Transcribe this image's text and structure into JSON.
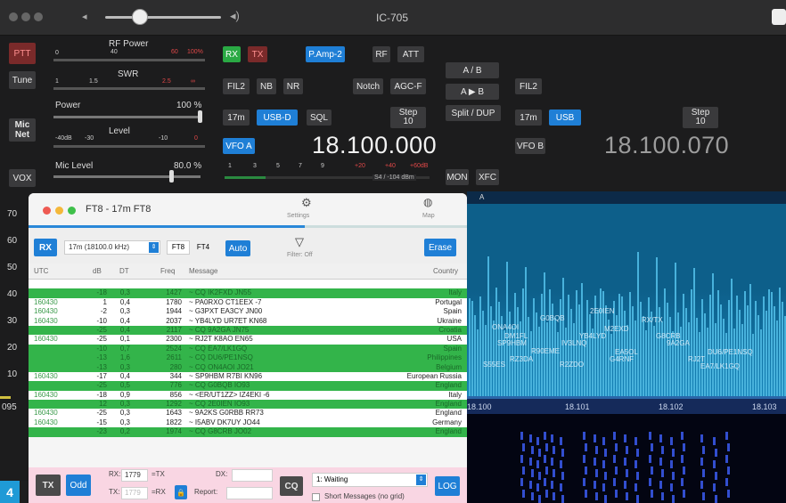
{
  "window": {
    "title": "IC-705"
  },
  "radio": {
    "ptt": "PTT",
    "tune": "Tune",
    "mic_net": "Mic\nNet",
    "vox": "VOX",
    "rf_power_label": "RF Power",
    "swr_label": "SWR",
    "power_label": "Power",
    "power_value": "100 %",
    "level_label": "Level",
    "mic_level_label": "Mic Level",
    "mic_level_value": "80.0 %",
    "rx": "RX",
    "tx": "TX",
    "pamp": "P.Amp-2",
    "rf": "RF",
    "att": "ATT",
    "fil2": "FIL2",
    "nb": "NB",
    "nr": "NR",
    "notch": "Notch",
    "agcf": "AGC-F",
    "band_a": "17m",
    "mode_a": "USB-D",
    "sql": "SQL",
    "step_label": "Step",
    "step_value": "10",
    "vfo_a": "VFO A",
    "freq_a": "18.100.000",
    "ab": "A / B",
    "a_to_b": "A ▶ B",
    "split": "Split / DUP",
    "fil2_b": "FIL2",
    "band_b": "17m",
    "mode_b": "USB",
    "step_b_label": "Step",
    "step_b_value": "10",
    "vfo_b": "VFO B",
    "freq_b": "18.100.070",
    "mon": "MON",
    "xfc": "XFC",
    "smeter_readout": "S4 / -104 dBm",
    "rf_ticks": [
      "0",
      "40",
      "60",
      "100%"
    ],
    "swr_ticks": [
      "1",
      "1.5",
      "2.5",
      "∞"
    ],
    "level_ticks": [
      "-40dB",
      "-30",
      "-10",
      "0"
    ],
    "s_ticks": [
      "1",
      "3",
      "5",
      "7",
      "9",
      "+20",
      "+40",
      "+60dB"
    ]
  },
  "axis_db": [
    "70",
    "60",
    "50",
    "40",
    "30",
    "20",
    "10"
  ],
  "axis_left_bottom": "095",
  "spectrum": {
    "label_a": "A",
    "freq_ticks": [
      "18.100",
      "18.101",
      "18.102",
      "18.103"
    ],
    "callsigns": [
      "2E0IEN",
      "RX/TX",
      "G0BQB",
      "ONA4OI",
      "DM1FL",
      "M2EXD",
      "SP9HBM",
      "YB4LYD",
      "G8CRB",
      "IV3LNQ",
      "9A2GA",
      "R90EME",
      "EA5OL",
      "DU6/PE1NSQ",
      "S55ES",
      "RZ3DA",
      "R2ZDO",
      "G4RNF",
      "RJ2T",
      "EA7/LK1GQ"
    ]
  },
  "ft8": {
    "title": "FT8 - 17m FT8",
    "settings": "Settings",
    "map": "Map",
    "rx_btn": "RX",
    "band_select": "17m (18100.0 kHz)",
    "ft8": "FT8",
    "ft4": "FT4",
    "auto": "Auto",
    "filter": "Filter: Off",
    "erase": "Erase",
    "headers": [
      "UTC",
      "dB",
      "DT",
      "Freq",
      "Message",
      "Country"
    ],
    "rows": [
      {
        "utc": "",
        "db": "",
        "dt": "",
        "freq": "",
        "msg": "",
        "country": "",
        "color": "white"
      },
      {
        "utc": "",
        "db": "-18",
        "dt": "0,3",
        "freq": "1427",
        "msg": "~ CQ IK2FXD JN55",
        "country": "Italy",
        "color": "green"
      },
      {
        "utc": "160430",
        "db": "1",
        "dt": "0,4",
        "freq": "1780",
        "msg": "~ PA0RXO CT1EEX -7",
        "country": "Portugal",
        "color": "white"
      },
      {
        "utc": "160430",
        "db": "-2",
        "dt": "0,3",
        "freq": "1944",
        "msg": "~ G3PXT EA3CY JN00",
        "country": "Spain",
        "color": "white"
      },
      {
        "utc": "160430",
        "db": "-10",
        "dt": "0,4",
        "freq": "2037",
        "msg": "~ YB4LYD UR7ET KN68",
        "country": "Ukraine",
        "color": "white"
      },
      {
        "utc": "",
        "db": "-25",
        "dt": "0,4",
        "freq": "2117",
        "msg": "~ CQ 9A2GA JN75",
        "country": "Croatia",
        "color": "green"
      },
      {
        "utc": "160430",
        "db": "-25",
        "dt": "0,1",
        "freq": "2300",
        "msg": "~ RJ2T K8AO EN65",
        "country": "USA",
        "color": "white"
      },
      {
        "utc": "",
        "db": "-10",
        "dt": "0,7",
        "freq": "2524",
        "msg": "~ CQ EA7/LK1GQ",
        "country": "Spain",
        "color": "green"
      },
      {
        "utc": "",
        "db": "-13",
        "dt": "1,6",
        "freq": "2611",
        "msg": "~ CQ DU6/PE1NSQ",
        "country": "Philippines",
        "color": "green"
      },
      {
        "utc": "",
        "db": "-13",
        "dt": "0,3",
        "freq": "280",
        "msg": "~ CQ ON4AOI JO21",
        "country": "Belgium",
        "color": "green"
      },
      {
        "utc": "160430",
        "db": "-17",
        "dt": "0,4",
        "freq": "344",
        "msg": "~ SP9HBM R7BI KN96",
        "country": "European Russia",
        "color": "white"
      },
      {
        "utc": "",
        "db": "-25",
        "dt": "0,5",
        "freq": "776",
        "msg": "~ CQ G0BQB IO93",
        "country": "England",
        "color": "green"
      },
      {
        "utc": "160430",
        "db": "-18",
        "dt": "0,9",
        "freq": "856",
        "msg": "~ <ER/UT1ZZ> IZ4EKI -6",
        "country": "Italy",
        "color": "white"
      },
      {
        "utc": "",
        "db": "12",
        "dt": "0,3",
        "freq": "1292",
        "msg": "~ CQ 2E0IEN IO93",
        "country": "England",
        "color": "green"
      },
      {
        "utc": "160430",
        "db": "-25",
        "dt": "0,3",
        "freq": "1643",
        "msg": "~ 9A2KS G0RBB RR73",
        "country": "England",
        "color": "white"
      },
      {
        "utc": "160430",
        "db": "-15",
        "dt": "0,3",
        "freq": "1822",
        "msg": "~ I5ABV DK7UY JO44",
        "country": "Germany",
        "color": "white"
      },
      {
        "utc": "",
        "db": "-23",
        "dt": "0,2",
        "freq": "1974",
        "msg": "~ CQ G8CRB JO02",
        "country": "England",
        "color": "green"
      }
    ],
    "bottom": {
      "tx": "TX",
      "odd": "Odd",
      "rx_label": "RX:",
      "rx_value": "1779",
      "eq_tx": "=TX",
      "tx_label": "TX:",
      "tx_value": "1779",
      "eq_rx": "=RX",
      "dx_label": "DX:",
      "report_label": "Report:",
      "cq": "CQ",
      "status": "1: Waiting",
      "short_msgs": "Short Messages (no grid)",
      "log": "LOG"
    }
  },
  "badge": "4"
}
